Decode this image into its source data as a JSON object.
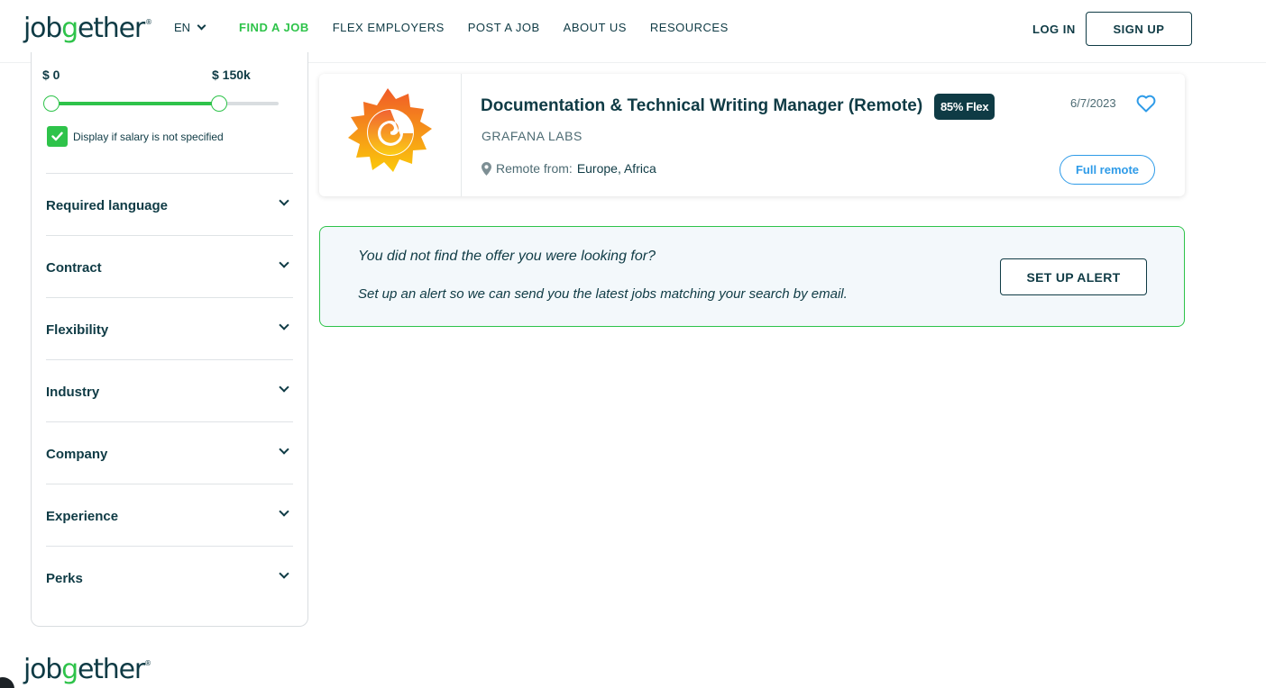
{
  "header": {
    "logo": {
      "pre": "job",
      "g": "g",
      "post": "ether",
      "reg": "®"
    },
    "language": "EN",
    "nav": [
      {
        "label": "FIND A JOB",
        "active": true
      },
      {
        "label": "FLEX EMPLOYERS",
        "active": false
      },
      {
        "label": "POST A JOB",
        "active": false
      },
      {
        "label": "ABOUT US",
        "active": false
      },
      {
        "label": "RESOURCES",
        "active": false
      }
    ],
    "login_label": "LOG IN",
    "signup_label": "SIGN UP"
  },
  "sidebar": {
    "salary": {
      "min_label": "$ 0",
      "max_label": "$ 150k",
      "range_fraction": [
        0.0,
        0.74
      ]
    },
    "display_unspecified": {
      "label": "Display if salary is not specified",
      "checked": true
    },
    "filters": [
      {
        "label": "Required language"
      },
      {
        "label": "Contract"
      },
      {
        "label": "Flexibility"
      },
      {
        "label": "Industry"
      },
      {
        "label": "Company"
      },
      {
        "label": "Experience"
      },
      {
        "label": "Perks"
      }
    ]
  },
  "job": {
    "title": "Documentation & Technical Writing Manager (Remote)",
    "flex_badge": "85% Flex",
    "company": "GRAFANA LABS",
    "location_label": "Remote from:",
    "location_value": "Europe, Africa",
    "date": "6/7/2023",
    "remote_type": "Full remote",
    "logo_icon": "grafana-logo-icon"
  },
  "alert": {
    "question": "You did not find the offer you were looking for?",
    "description": "Set up an alert so we can send you the latest jobs matching your search by email.",
    "button_label": "SET UP ALERT"
  },
  "footer": {
    "logo": {
      "pre": "job",
      "g": "g",
      "post": "ether",
      "reg": "®"
    }
  },
  "colors": {
    "brand_dark": "#0f3b45",
    "brand_green": "#2ec34a",
    "accent_blue": "#2e9be8",
    "alert_bg": "#f3f8fb"
  }
}
